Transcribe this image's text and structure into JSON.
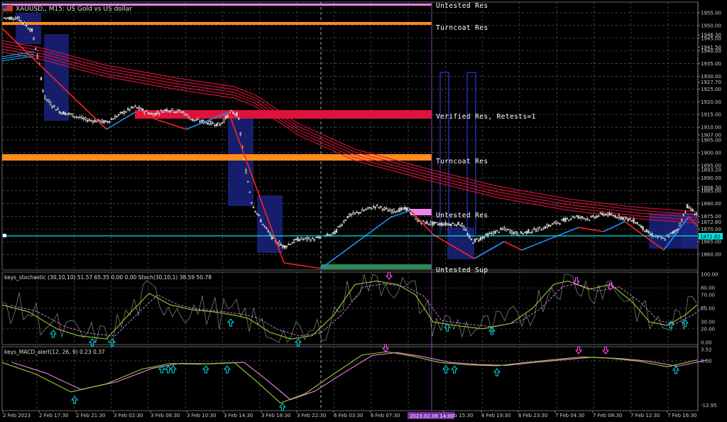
{
  "window": {
    "title": "XAUUSD,, M15: US Gold vs US dollar"
  },
  "price_panel": {
    "price_labels": [
      "1955.00",
      "1950.00",
      "1946.30",
      "1945.00",
      "1941.50",
      "1940.00",
      "1935.00",
      "1930.00",
      "1927.70",
      "1925.00",
      "1920.00",
      "1915.00",
      "1910.00",
      "1907.00",
      "1905.00",
      "1900.00",
      "1895.00",
      "1893.20",
      "1890.00",
      "1886.30",
      "1885.00",
      "1880.00",
      "1875.00",
      "1872.80",
      "1870.00",
      "1865.00",
      "1860.00"
    ],
    "current_price": "1871.82"
  },
  "sr_zones": [
    {
      "label": "Untested Res",
      "color": "#ee82ee"
    },
    {
      "label": "Turncoat Res",
      "color": "#ff8c1a"
    },
    {
      "label": "Verified Res, Retests=1",
      "color": "#dc143c"
    },
    {
      "label": "Turncoat Res",
      "color": "#ff8c1a"
    },
    {
      "label": "Untested Res",
      "color": "#ee82ee"
    },
    {
      "label": "Untested Sup",
      "color": "#2e8b57"
    }
  ],
  "stochastic": {
    "header": "keys_stochastic (30,10,10) 51.57 65.35 0.00 0.00 Stoch(30,10,1) 38.59 50.78",
    "levels": [
      "100.00",
      "80.00",
      "70.00",
      "50.00",
      "30.00",
      "20.00",
      "0.00"
    ]
  },
  "macd": {
    "header": "keys_MACD_alert(12, 26, 9) 0.23 0.37",
    "levels": [
      "3.52",
      "0.00",
      "-12.95"
    ]
  },
  "time_axis": {
    "labels": [
      "2 Feb 2023",
      "2 Feb 17:30",
      "2 Feb 21:30",
      "3 Feb 02:30",
      "3 Feb 06:30",
      "3 Feb 10:30",
      "3 Feb 14:30",
      "3 Feb 18:30",
      "3 Feb 22:30",
      "6 Feb 03:30",
      "6 Feb 07:30",
      "6 Feb 15:30",
      "6 Feb 19:30",
      "6 Feb 23:30",
      "7 Feb 04:30",
      "7 Feb 08:30",
      "7 Feb 12:30",
      "7 Feb 16:30"
    ],
    "crosshair_time": "2023.02.06 14:00"
  },
  "colors": {
    "background": "#000000",
    "bull_candle": "#ffffff",
    "zigzag_up": "#1e90ff",
    "zigzag_down": "#ff2020",
    "ma_band": "#dc143c",
    "cyan_line": "#00e5e5",
    "stoch_main": "#9acd32",
    "stoch_signal": "#ee82ee",
    "arrow_up": "#00ced1",
    "arrow_down": "#ff4dff"
  }
}
